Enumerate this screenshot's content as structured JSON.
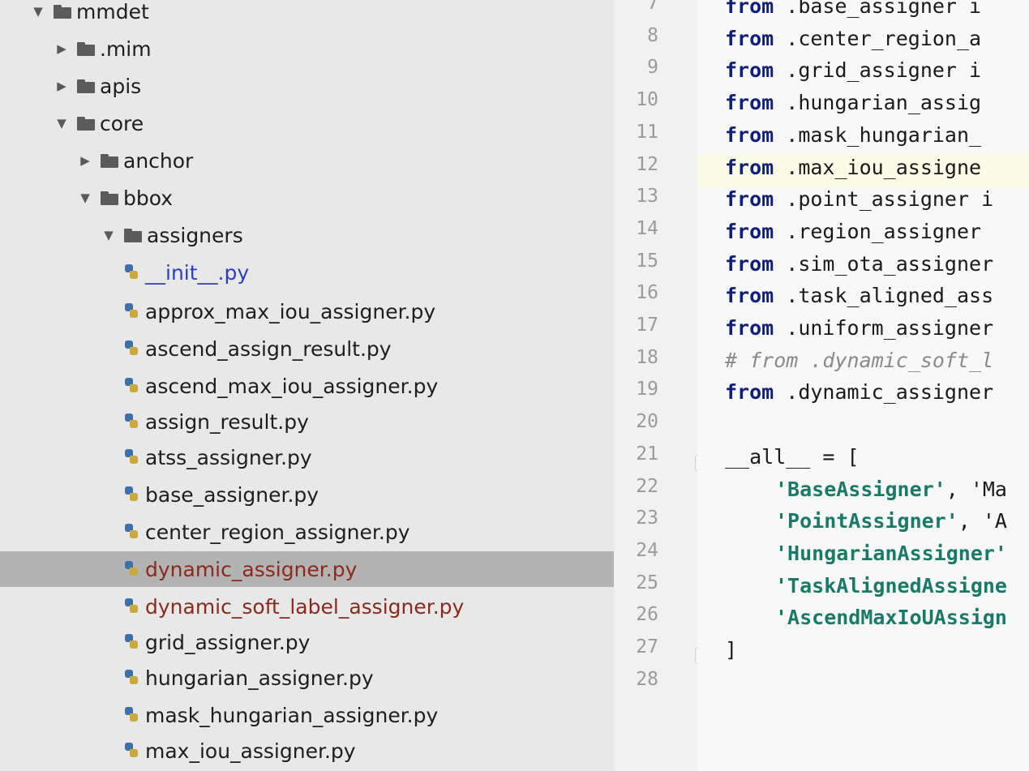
{
  "project_tree": {
    "items": [
      {
        "label": "mmdet",
        "kind": "folder",
        "expanded": true
      },
      {
        "label": ".mim",
        "kind": "folder",
        "expanded": false
      },
      {
        "label": "apis",
        "kind": "folder",
        "expanded": false
      },
      {
        "label": "core",
        "kind": "folder",
        "expanded": true
      },
      {
        "label": "anchor",
        "kind": "folder",
        "expanded": false
      },
      {
        "label": "bbox",
        "kind": "folder",
        "expanded": true
      },
      {
        "label": "assigners",
        "kind": "folder",
        "expanded": true
      },
      {
        "label": "__init__.py",
        "kind": "file"
      },
      {
        "label": "approx_max_iou_assigner.py",
        "kind": "file"
      },
      {
        "label": "ascend_assign_result.py",
        "kind": "file"
      },
      {
        "label": "ascend_max_iou_assigner.py",
        "kind": "file"
      },
      {
        "label": "assign_result.py",
        "kind": "file"
      },
      {
        "label": "atss_assigner.py",
        "kind": "file"
      },
      {
        "label": "base_assigner.py",
        "kind": "file"
      },
      {
        "label": "center_region_assigner.py",
        "kind": "file"
      },
      {
        "label": "dynamic_assigner.py",
        "kind": "file",
        "selected": true
      },
      {
        "label": "dynamic_soft_label_assigner.py",
        "kind": "file"
      },
      {
        "label": "grid_assigner.py",
        "kind": "file"
      },
      {
        "label": "hungarian_assigner.py",
        "kind": "file"
      },
      {
        "label": "mask_hungarian_assigner.py",
        "kind": "file"
      },
      {
        "label": "max_iou_assigner.py",
        "kind": "file"
      }
    ],
    "icons": {
      "expanded": "triangle-down-icon",
      "collapsed": "triangle-right-icon",
      "folder": "folder-icon",
      "file": "python-file-icon"
    }
  },
  "editor": {
    "current_line": "12",
    "lines": [
      {
        "n": "7",
        "kw": "from",
        "rest": " .base_assigner i"
      },
      {
        "n": "8",
        "kw": "from",
        "rest": " .center_region_a"
      },
      {
        "n": "9",
        "kw": "from",
        "rest": " .grid_assigner i"
      },
      {
        "n": "10",
        "kw": "from",
        "rest": " .hungarian_assig"
      },
      {
        "n": "11",
        "kw": "from",
        "rest": " .mask_hungarian_"
      },
      {
        "n": "12",
        "kw": "from",
        "rest": " .max_iou_assigne"
      },
      {
        "n": "13",
        "kw": "from",
        "rest": " .point_assigner i"
      },
      {
        "n": "14",
        "kw": "from",
        "rest": " .region_assigner"
      },
      {
        "n": "15",
        "kw": "from",
        "rest": " .sim_ota_assigner"
      },
      {
        "n": "16",
        "kw": "from",
        "rest": " .task_aligned_ass"
      },
      {
        "n": "17",
        "kw": "from",
        "rest": " .uniform_assigner"
      },
      {
        "n": "18",
        "comment": "# from .dynamic_soft_l"
      },
      {
        "n": "19",
        "kw": "from",
        "rest": " .dynamic_assigner"
      },
      {
        "n": "20",
        "plain": ""
      },
      {
        "n": "21",
        "plain": "__all__ = ["
      },
      {
        "n": "22",
        "str": "'BaseAssigner'",
        "after": ", 'Ma"
      },
      {
        "n": "23",
        "str": "'PointAssigner'",
        "after": ", 'A"
      },
      {
        "n": "24",
        "str": "'HungarianAssigner'",
        "after": ""
      },
      {
        "n": "25",
        "str": "'TaskAlignedAssigne",
        "after": ""
      },
      {
        "n": "26",
        "str": "'AscendMaxIoUAssign",
        "after": ""
      },
      {
        "n": "27",
        "plain": "]"
      },
      {
        "n": "28",
        "plain": ""
      }
    ]
  },
  "colors": {
    "keyword": "#0f1f7a",
    "string": "#1a7a6a",
    "comment": "#8a8a8a",
    "selection": "#b3b3b3"
  }
}
